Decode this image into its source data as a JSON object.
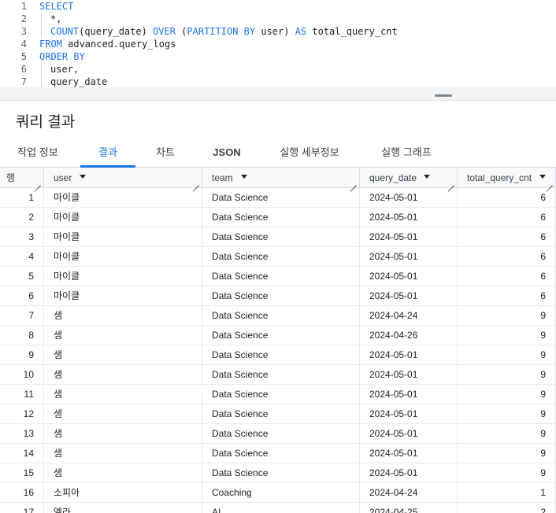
{
  "editor": {
    "lines": [
      {
        "n": "1",
        "tokens": [
          {
            "t": "SELECT",
            "c": "kw"
          }
        ],
        "indent": false
      },
      {
        "n": "2",
        "tokens": [
          {
            "t": "*,",
            "c": "plain"
          }
        ],
        "indent": true
      },
      {
        "n": "3",
        "tokens": [
          {
            "t": "COUNT",
            "c": "fn"
          },
          {
            "t": "(query_date) ",
            "c": "plain"
          },
          {
            "t": "OVER",
            "c": "kw"
          },
          {
            "t": " (",
            "c": "plain"
          },
          {
            "t": "PARTITION BY",
            "c": "kw"
          },
          {
            "t": " user) ",
            "c": "plain"
          },
          {
            "t": "AS",
            "c": "kw"
          },
          {
            "t": " total_query_cnt",
            "c": "plain"
          }
        ],
        "indent": true
      },
      {
        "n": "4",
        "tokens": [
          {
            "t": "FROM",
            "c": "kw"
          },
          {
            "t": " advanced.query_logs",
            "c": "plain"
          }
        ],
        "indent": false
      },
      {
        "n": "5",
        "tokens": [
          {
            "t": "ORDER BY",
            "c": "kw"
          }
        ],
        "indent": false
      },
      {
        "n": "6",
        "tokens": [
          {
            "t": "user,",
            "c": "plain"
          }
        ],
        "indent": true
      },
      {
        "n": "7",
        "tokens": [
          {
            "t": "query_date",
            "c": "plain"
          }
        ],
        "indent": true
      }
    ]
  },
  "results": {
    "title": "쿼리 결과",
    "tabs": [
      {
        "label": "작업 정보",
        "active": false
      },
      {
        "label": "결과",
        "active": true
      },
      {
        "label": "차트",
        "active": false
      },
      {
        "label": "JSON",
        "active": false
      },
      {
        "label": "실행 세부정보",
        "active": false
      },
      {
        "label": "실행 그래프",
        "active": false
      }
    ],
    "columns": [
      {
        "label": "행",
        "sortable": false
      },
      {
        "label": "user",
        "sortable": true
      },
      {
        "label": "team",
        "sortable": true
      },
      {
        "label": "query_date",
        "sortable": true
      },
      {
        "label": "total_query_cnt",
        "sortable": true
      }
    ],
    "rows": [
      [
        "1",
        "마이클",
        "Data Science",
        "2024-05-01",
        "6"
      ],
      [
        "2",
        "마이클",
        "Data Science",
        "2024-05-01",
        "6"
      ],
      [
        "3",
        "마이클",
        "Data Science",
        "2024-05-01",
        "6"
      ],
      [
        "4",
        "마이클",
        "Data Science",
        "2024-05-01",
        "6"
      ],
      [
        "5",
        "마이클",
        "Data Science",
        "2024-05-01",
        "6"
      ],
      [
        "6",
        "마이클",
        "Data Science",
        "2024-05-01",
        "6"
      ],
      [
        "7",
        "샘",
        "Data Science",
        "2024-04-24",
        "9"
      ],
      [
        "8",
        "샘",
        "Data Science",
        "2024-04-26",
        "9"
      ],
      [
        "9",
        "샘",
        "Data Science",
        "2024-05-01",
        "9"
      ],
      [
        "10",
        "샘",
        "Data Science",
        "2024-05-01",
        "9"
      ],
      [
        "11",
        "샘",
        "Data Science",
        "2024-05-01",
        "9"
      ],
      [
        "12",
        "샘",
        "Data Science",
        "2024-05-01",
        "9"
      ],
      [
        "13",
        "샘",
        "Data Science",
        "2024-05-01",
        "9"
      ],
      [
        "14",
        "샘",
        "Data Science",
        "2024-05-01",
        "9"
      ],
      [
        "15",
        "샘",
        "Data Science",
        "2024-05-01",
        "9"
      ],
      [
        "16",
        "소피아",
        "Coaching",
        "2024-04-24",
        "1"
      ],
      [
        "17",
        "엘라",
        "AI",
        "2024-04-25",
        "2"
      ]
    ]
  },
  "colors": {
    "accent": "#1a73e8",
    "keyword": "#1a73e8"
  }
}
